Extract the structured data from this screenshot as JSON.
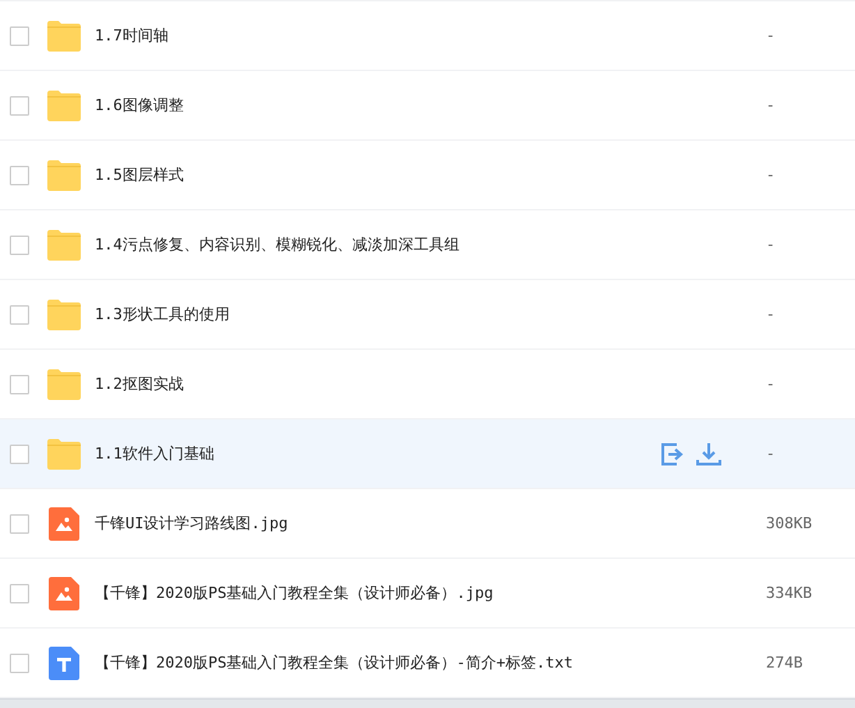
{
  "files": [
    {
      "kind": "folder",
      "name": "1.7时间轴",
      "size": "-",
      "hovered": false
    },
    {
      "kind": "folder",
      "name": "1.6图像调整",
      "size": "-",
      "hovered": false
    },
    {
      "kind": "folder",
      "name": "1.5图层样式",
      "size": "-",
      "hovered": false
    },
    {
      "kind": "folder",
      "name": "1.4污点修复、内容识别、模糊锐化、减淡加深工具组",
      "size": "-",
      "hovered": false
    },
    {
      "kind": "folder",
      "name": "1.3形状工具的使用",
      "size": "-",
      "hovered": false
    },
    {
      "kind": "folder",
      "name": "1.2抠图实战",
      "size": "-",
      "hovered": false
    },
    {
      "kind": "folder",
      "name": "1.1软件入门基础",
      "size": "-",
      "hovered": true
    },
    {
      "kind": "image",
      "name": "千锋UI设计学习路线图.jpg",
      "size": "308KB",
      "hovered": false
    },
    {
      "kind": "image",
      "name": "【千锋】2020版PS基础入门教程全集（设计师必备）.jpg",
      "size": "334KB",
      "hovered": false
    },
    {
      "kind": "text",
      "name": "【千锋】2020版PS基础入门教程全集（设计师必备）-简介+标签.txt",
      "size": "274B",
      "hovered": false
    }
  ]
}
